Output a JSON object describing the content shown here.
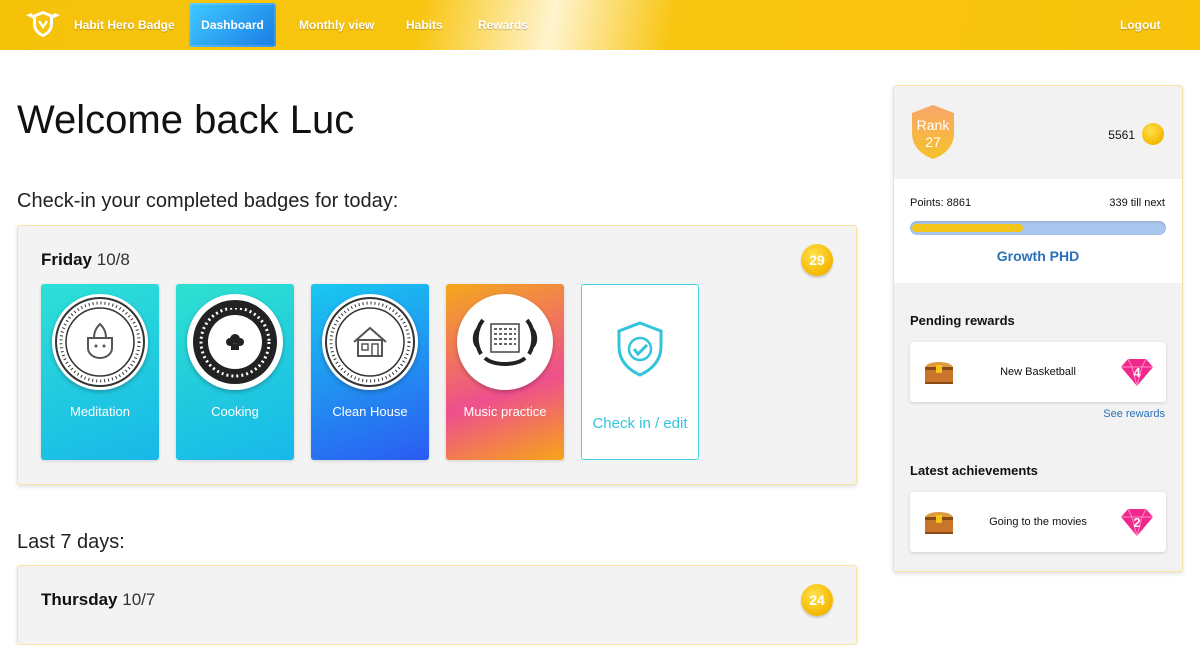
{
  "nav": {
    "brand": "Habit Hero Badge",
    "items": [
      "Dashboard",
      "Monthly view",
      "Habits",
      "Rewards"
    ],
    "active": "Dashboard",
    "logout": "Logout",
    "logo_icon": "shield-badge-logo-icon"
  },
  "main": {
    "welcome": "Welcome back Luc",
    "checkin_heading": "Check-in your completed badges for today:",
    "last7_heading": "Last 7 days:",
    "today": {
      "weekday": "Friday",
      "date": "10/8",
      "points": "29",
      "badges": [
        {
          "label": "Meditation",
          "icon": "meditation-pot-icon"
        },
        {
          "label": "Cooking",
          "icon": "chef-hat-icon"
        },
        {
          "label": "Clean House",
          "icon": "house-icon"
        },
        {
          "label": "Music practice",
          "icon": "sheet-music-icon"
        }
      ],
      "checkin_label": "Check in / edit",
      "checkin_icon": "shield-check-icon"
    },
    "previous": {
      "weekday": "Thursday",
      "date": "10/7",
      "points": "24"
    }
  },
  "sidebar": {
    "rank_label": "Rank",
    "rank_value": "27",
    "coins": "5561",
    "points_label": "Points: 8861",
    "till_next": "339 till next",
    "progress_fraction": 0.44,
    "level_name": "Growth PHD",
    "pending_heading": "Pending rewards",
    "pending": [
      {
        "title": "New Basketball",
        "gems": "4"
      }
    ],
    "see_rewards": "See rewards",
    "achievements_heading": "Latest achievements",
    "achievements": [
      {
        "title": "Going to the movies",
        "gems": "2"
      }
    ]
  },
  "colors": {
    "nav_yellow": "#f7c30b",
    "active_blue": "#1a7de6",
    "accent_cyan": "#32c4dc",
    "coin_gold": "#f5b800",
    "level_blue": "#2a71b8",
    "gem_pink": "#f0288c"
  }
}
